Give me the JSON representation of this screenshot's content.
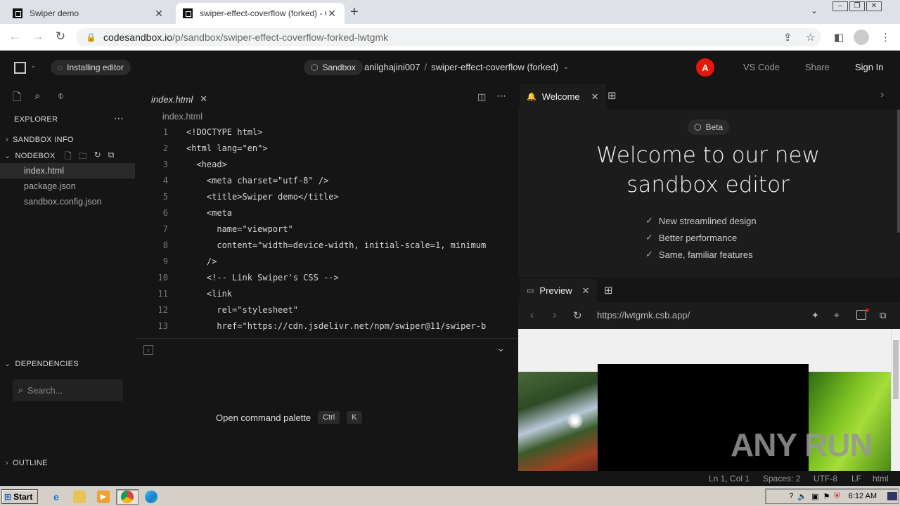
{
  "browser": {
    "tabs": [
      {
        "title": "Swiper demo",
        "active": false
      },
      {
        "title": "swiper-effect-coverflow (forked) - C",
        "active": true
      }
    ],
    "url_host": "codesandbox.io",
    "url_path": "/p/sandbox/swiper-effect-coverflow-forked-lwtgmk"
  },
  "topbar": {
    "status": "Installing editor",
    "sandbox_label": "Sandbox",
    "owner": "anilghajini007",
    "separator": "/",
    "project": "swiper-effect-coverflow (forked)",
    "avatar_letter": "A",
    "avatar_color": "#e3170a",
    "vscode": "VS Code",
    "share": "Share",
    "signin": "Sign In"
  },
  "sidebar": {
    "explorer": "EXPLORER",
    "sandbox_info": "SANDBOX INFO",
    "nodebox": "NODEBOX",
    "files": [
      "index.html",
      "package.json",
      "sandbox.config.json"
    ],
    "dependencies": "DEPENDENCIES",
    "search_placeholder": "Search...",
    "outline": "OUTLINE"
  },
  "editor": {
    "tab": "index.html",
    "breadcrumb": "index.html",
    "lines": [
      {
        "n": "1",
        "text": "<!DOCTYPE html>"
      },
      {
        "n": "2",
        "text": "<html lang=\"en\">"
      },
      {
        "n": "3",
        "text": "  <head>"
      },
      {
        "n": "4",
        "text": "    <meta charset=\"utf-8\" />"
      },
      {
        "n": "5",
        "text": "    <title>Swiper demo</title>"
      },
      {
        "n": "6",
        "text": "    <meta"
      },
      {
        "n": "7",
        "text": "      name=\"viewport\""
      },
      {
        "n": "8",
        "text": "      content=\"width=device-width, initial-scale=1, minimum"
      },
      {
        "n": "9",
        "text": "    />"
      },
      {
        "n": "10",
        "text": "    <!-- Link Swiper's CSS -->"
      },
      {
        "n": "11",
        "text": "    <link"
      },
      {
        "n": "12",
        "text": "      rel=\"stylesheet\""
      },
      {
        "n": "13",
        "text": "      href=\"https://cdn.jsdelivr.net/npm/swiper@11/swiper-b"
      }
    ],
    "command_palette": "Open command palette",
    "key1": "Ctrl",
    "key2": "K"
  },
  "welcome": {
    "tab": "Welcome",
    "beta": "Beta",
    "title_line1": "Welcome to our new",
    "title_line2": "sandbox editor",
    "features": [
      "New streamlined design",
      "Better performance",
      "Same, familiar features"
    ]
  },
  "preview": {
    "tab": "Preview",
    "url": "https://lwtgmk.csb.app/"
  },
  "statusbar": {
    "position": "Ln 1, Col 1",
    "spaces": "Spaces: 2",
    "encoding": "UTF-8",
    "eol": "LF",
    "language": "html"
  },
  "taskbar": {
    "start": "Start",
    "time": "6:12 AM"
  },
  "watermark": "ANY RUN"
}
